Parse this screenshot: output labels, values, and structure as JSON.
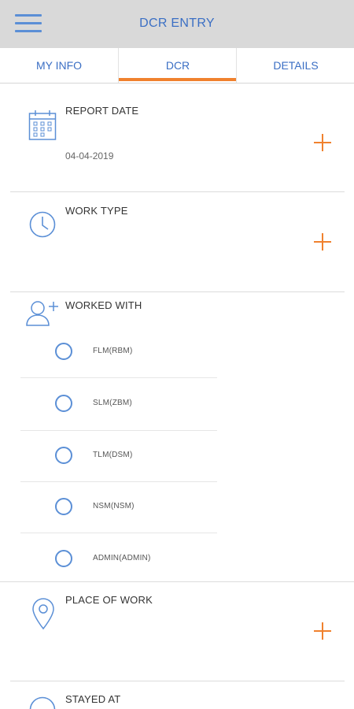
{
  "header": {
    "title": "DCR ENTRY",
    "menu_icon": "hamburger-menu-icon"
  },
  "tabs": [
    {
      "label": "MY INFO",
      "active": false
    },
    {
      "label": "DCR",
      "active": true
    },
    {
      "label": "DETAILS",
      "active": false
    }
  ],
  "report_date": {
    "label": "REPORT DATE",
    "value": "04-04-2019",
    "icon": "calendar-icon"
  },
  "work_type": {
    "label": "WORK TYPE",
    "icon": "clock-icon"
  },
  "worked_with": {
    "label": "WORKED WITH",
    "icon": "add-user-icon",
    "options": [
      {
        "label": "FLM(RBM)"
      },
      {
        "label": "SLM(ZBM)"
      },
      {
        "label": "TLM(DSM)"
      },
      {
        "label": "NSM(NSM)"
      },
      {
        "label": "ADMIN(ADMIN)"
      }
    ]
  },
  "place_of_work": {
    "label": "PLACE OF WORK",
    "icon": "location-pin-icon"
  },
  "stayed_at": {
    "label": "STAYED AT"
  },
  "colors": {
    "accent": "#f0812e",
    "primary": "#3b6fc4",
    "icon_blue": "#5b8fd6",
    "header_bg": "#d9d9d9"
  }
}
